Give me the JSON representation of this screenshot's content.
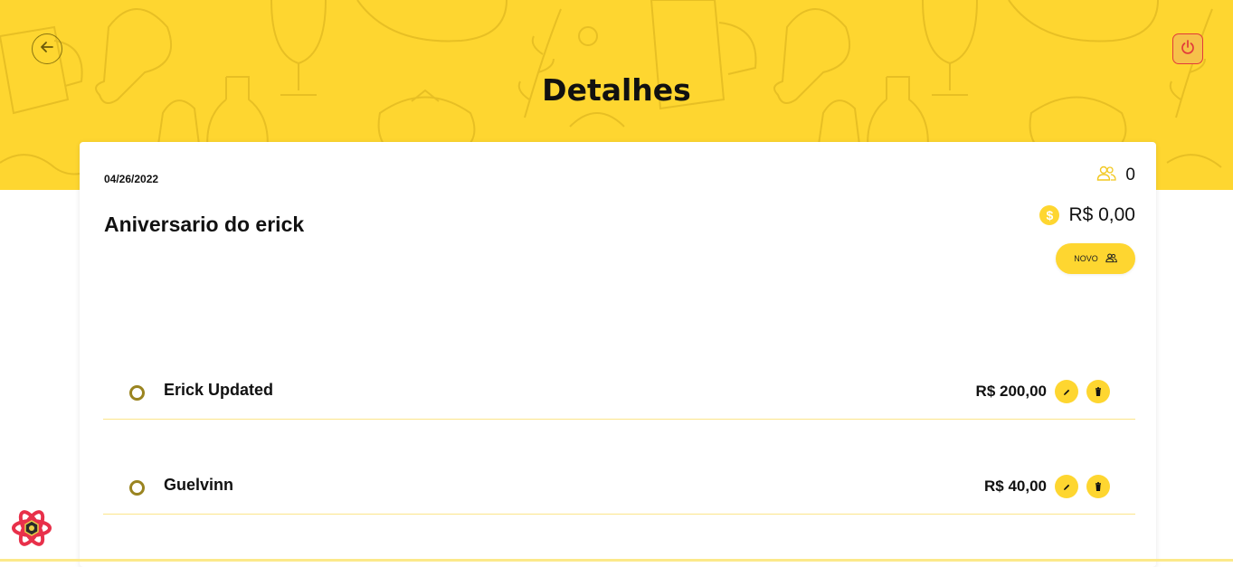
{
  "header": {
    "title": "Detalhes"
  },
  "event": {
    "date": "04/26/2022",
    "name": "Aniversario do erick",
    "people_count": "0",
    "total": "R$ 0,00",
    "new_button_label": "NOVO"
  },
  "participants": [
    {
      "name": "Erick Updated",
      "value": "R$ 200,00"
    },
    {
      "name": "Guelvinn",
      "value": "R$ 40,00"
    }
  ],
  "colors": {
    "accent": "#fed630",
    "accent_dark": "#9a8420",
    "danger": "#e23a3a"
  },
  "icons": {
    "back": "arrow-left-icon",
    "logout": "power-icon",
    "people": "users-icon",
    "money": "dollar-coin-icon",
    "edit": "pencil-icon",
    "delete": "trash-icon",
    "devtools": "react-logo-icon"
  }
}
